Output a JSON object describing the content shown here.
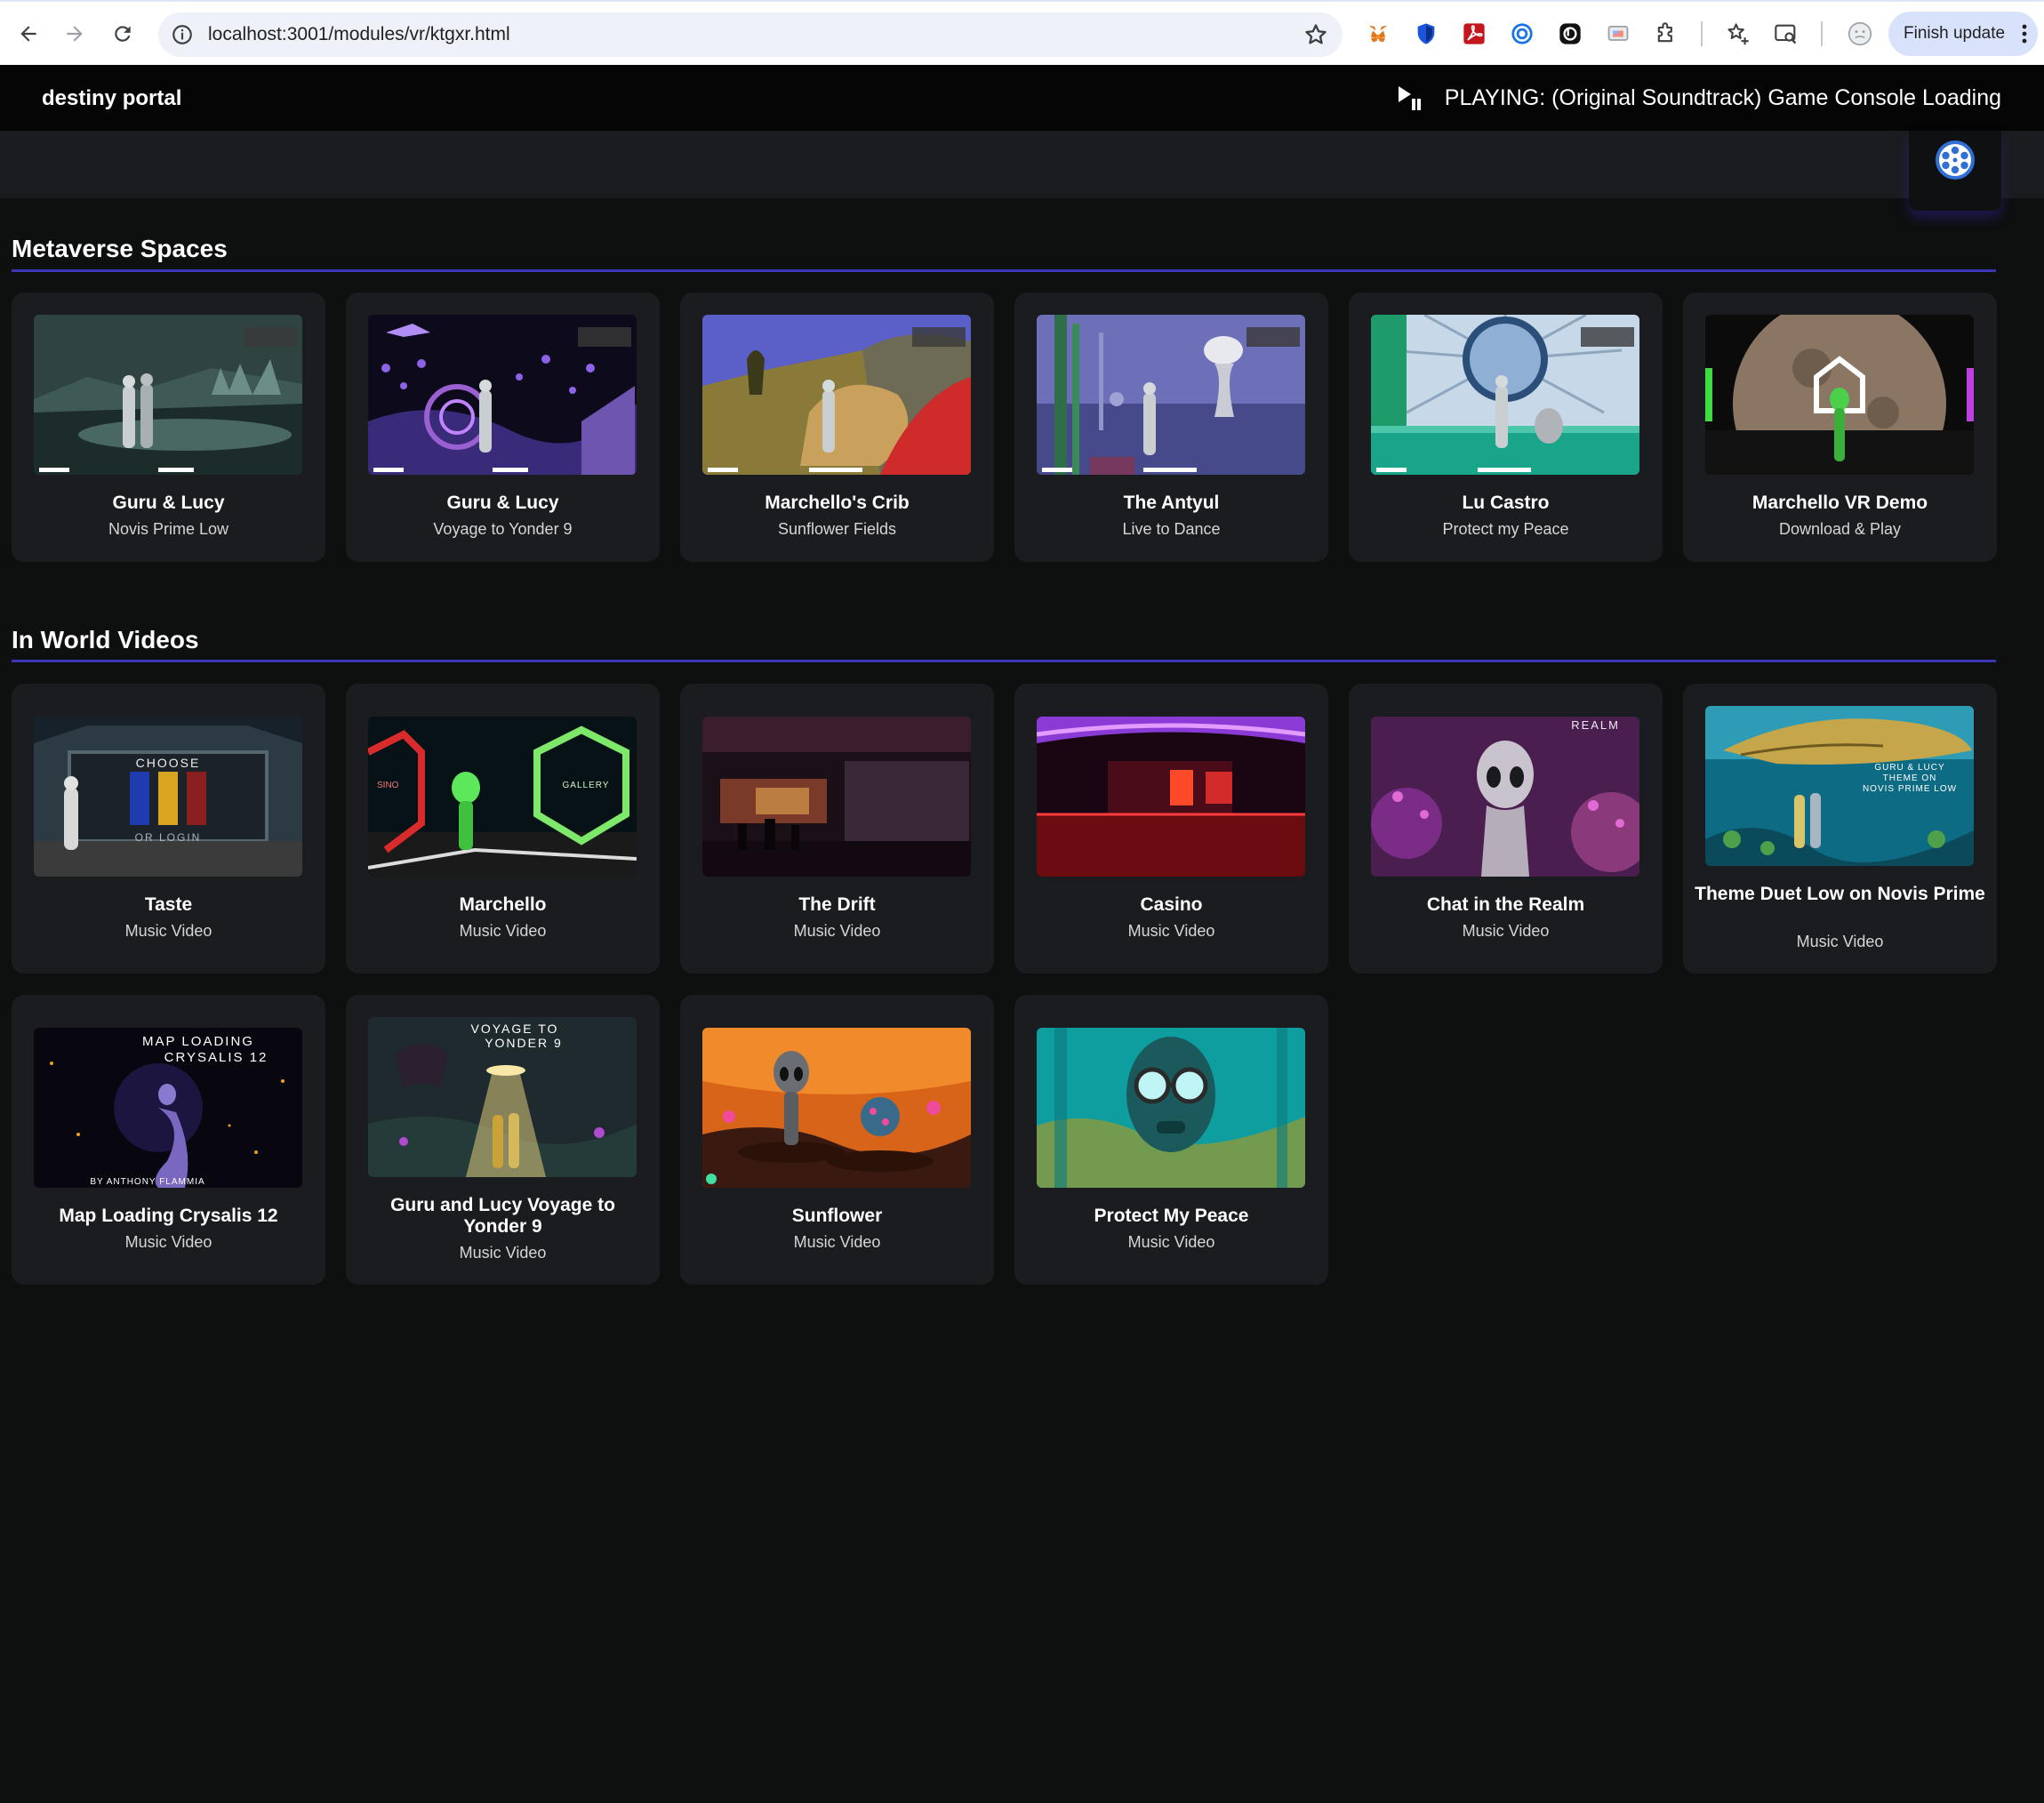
{
  "browser": {
    "url": "localhost:3001/modules/vr/ktgxr.html",
    "finish_update_label": "Finish update"
  },
  "app": {
    "brand": "destiny portal",
    "now_playing": "PLAYING: (Original Soundtrack) Game Console Loading"
  },
  "sections": {
    "metaverse": {
      "title": "Metaverse Spaces",
      "cards": [
        {
          "title": "Guru & Lucy",
          "subtitle": "Novis Prime Low"
        },
        {
          "title": "Guru & Lucy",
          "subtitle": "Voyage to Yonder 9"
        },
        {
          "title": "Marchello's Crib",
          "subtitle": "Sunflower Fields"
        },
        {
          "title": "The Antyul",
          "subtitle": "Live to Dance"
        },
        {
          "title": "Lu Castro",
          "subtitle": "Protect my Peace"
        },
        {
          "title": "Marchello VR Demo",
          "subtitle": "Download & Play"
        }
      ]
    },
    "videos": {
      "title": "In World Videos",
      "cards": [
        {
          "title": "Taste",
          "subtitle": "Music Video",
          "thumb_text": [
            "CHOOSE",
            "OR LOGIN"
          ]
        },
        {
          "title": "Marchello",
          "subtitle": "Music Video",
          "thumb_text": [
            "GALLERY",
            "SINO"
          ]
        },
        {
          "title": "The Drift",
          "subtitle": "Music Video"
        },
        {
          "title": "Casino",
          "subtitle": "Music Video"
        },
        {
          "title": "Chat in the Realm",
          "subtitle": "Music Video",
          "thumb_text": [
            "REALM"
          ]
        },
        {
          "title": "Theme Duet Low on Novis Prime",
          "subtitle": "Music Video",
          "thumb_text": [
            "GURU & LUCY",
            "THEME ON",
            "NOVIS PRIME LOW"
          ]
        },
        {
          "title": "Map Loading Crysalis 12",
          "subtitle": "Music Video",
          "thumb_text": [
            "MAP LOADING",
            "CRYSALIS 12",
            "BY ANTHONY FLAMMIA"
          ]
        },
        {
          "title": "Guru and Lucy Voyage to Yonder 9",
          "subtitle": "Music Video",
          "thumb_text": [
            "VOYAGE TO",
            "YONDER 9"
          ]
        },
        {
          "title": "Sunflower",
          "subtitle": "Music Video"
        },
        {
          "title": "Protect My Peace",
          "subtitle": "Music Video"
        }
      ]
    }
  }
}
